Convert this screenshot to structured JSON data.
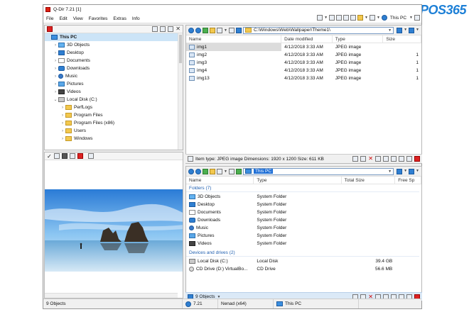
{
  "window": {
    "title": "Q-Dir 7.21 [1]"
  },
  "menu": [
    "File",
    "Edit",
    "View",
    "Favorites",
    "Extras",
    "Info"
  ],
  "toolbar": {
    "location": "This PC"
  },
  "watermark": {
    "text": "POS365"
  },
  "tree": {
    "items": [
      {
        "label": "This PC",
        "icon": "pc",
        "level": 0,
        "selected": true
      },
      {
        "label": "3D Objects",
        "icon": "obj",
        "level": 1
      },
      {
        "label": "Desktop",
        "icon": "desk",
        "level": 1
      },
      {
        "label": "Documents",
        "icon": "doc",
        "level": 1
      },
      {
        "label": "Downloads",
        "icon": "down",
        "level": 1
      },
      {
        "label": "Music",
        "icon": "music",
        "level": 1
      },
      {
        "label": "Pictures",
        "icon": "pics",
        "level": 1
      },
      {
        "label": "Videos",
        "icon": "video",
        "level": 1
      },
      {
        "label": "Local Disk (C:)",
        "icon": "drive",
        "level": 1,
        "expanded": true
      },
      {
        "label": "PerfLogs",
        "icon": "folder",
        "level": 2
      },
      {
        "label": "Program Files",
        "icon": "folder",
        "level": 2
      },
      {
        "label": "Program Files (x86)",
        "icon": "folder",
        "level": 2
      },
      {
        "label": "Users",
        "icon": "folder",
        "level": 2
      },
      {
        "label": "Windows",
        "icon": "folder",
        "level": 2
      }
    ]
  },
  "pane1": {
    "path": "C:\\Windows\\Web\\Wallpaper\\Theme1\\",
    "columns": [
      "Name",
      "Date modified",
      "Type",
      "Size"
    ],
    "rows": [
      {
        "name": "img1",
        "date": "4/12/2018 3:33 AM",
        "type": "JPEG image",
        "size": "",
        "selected": true
      },
      {
        "name": "img2",
        "date": "4/12/2018 3:33 AM",
        "type": "JPEG image",
        "size": "1"
      },
      {
        "name": "img3",
        "date": "4/12/2018 3:33 AM",
        "type": "JPEG image",
        "size": "1"
      },
      {
        "name": "img4",
        "date": "4/12/2018 3:33 AM",
        "type": "JPEG image",
        "size": "1"
      },
      {
        "name": "img13",
        "date": "4/12/2018 3:33 AM",
        "type": "JPEG image",
        "size": "1"
      }
    ],
    "status": "Item type: JPEG image Dimensions: 1920 x 1200 Size: 611 KB"
  },
  "pane2": {
    "path": "This PC",
    "columns": [
      "Name",
      "Type",
      "Total Size",
      "Free Sp"
    ],
    "group_folders": "Folders (7)",
    "folders": [
      {
        "name": "3D Objects",
        "type": "System Folder",
        "icon": "obj"
      },
      {
        "name": "Desktop",
        "type": "System Folder",
        "icon": "desk"
      },
      {
        "name": "Documents",
        "type": "System Folder",
        "icon": "doc"
      },
      {
        "name": "Downloads",
        "type": "System Folder",
        "icon": "down"
      },
      {
        "name": "Music",
        "type": "System Folder",
        "icon": "music"
      },
      {
        "name": "Pictures",
        "type": "System Folder",
        "icon": "pics"
      },
      {
        "name": "Videos",
        "type": "System Folder",
        "icon": "video"
      }
    ],
    "group_drives": "Devices and drives (2)",
    "drives": [
      {
        "name": "Local Disk (C:)",
        "type": "Local Disk",
        "total": "39.4 GB",
        "icon": "drive"
      },
      {
        "name": "CD Drive (D:) VirtualBo...",
        "type": "CD Drive",
        "total": "56.6 MB",
        "icon": "cd"
      }
    ],
    "status": "9 Objects"
  },
  "bottom": {
    "objects": "9 Objects",
    "version": "7.21",
    "user": "Nenad (x64)",
    "location": "This PC"
  }
}
